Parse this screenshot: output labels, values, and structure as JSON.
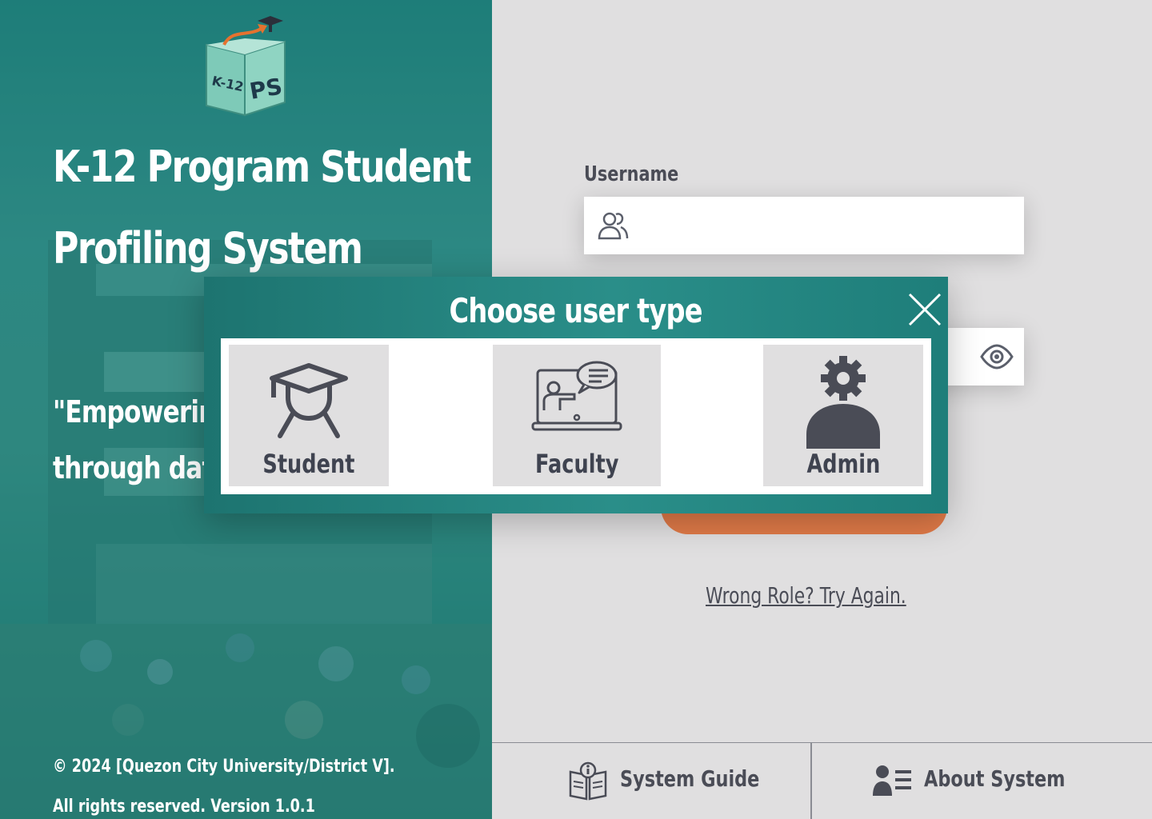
{
  "app": {
    "title": "K-12 Program Student Profiling System",
    "title_line1": "K-12 Program Student",
    "title_line2": "Profiling System",
    "logo": {
      "text_left": "K-12",
      "text_right": "PS"
    },
    "tagline": "\"Empowerin\nthrough dat",
    "copyright": "© 2024 [Quezon City University/District V].",
    "rights": "All rights reserved. Version 1.0.1"
  },
  "login": {
    "username_label": "Username",
    "username_value": "",
    "password_value": "",
    "wrong_role": "Wrong Role? Try Again."
  },
  "footer_nav": {
    "guide_label": "System Guide",
    "about_label": "About System"
  },
  "modal": {
    "title": "Choose user type",
    "options": [
      {
        "label": "Student",
        "icon": "graduation-cap-icon"
      },
      {
        "label": "Faculty",
        "icon": "teacher-board-icon"
      },
      {
        "label": "Admin",
        "icon": "admin-gear-icon"
      }
    ]
  },
  "colors": {
    "teal": "#1f7b78",
    "orange": "#e07a48",
    "background": "#e0dfe0",
    "text_dark": "#4a4c56"
  }
}
